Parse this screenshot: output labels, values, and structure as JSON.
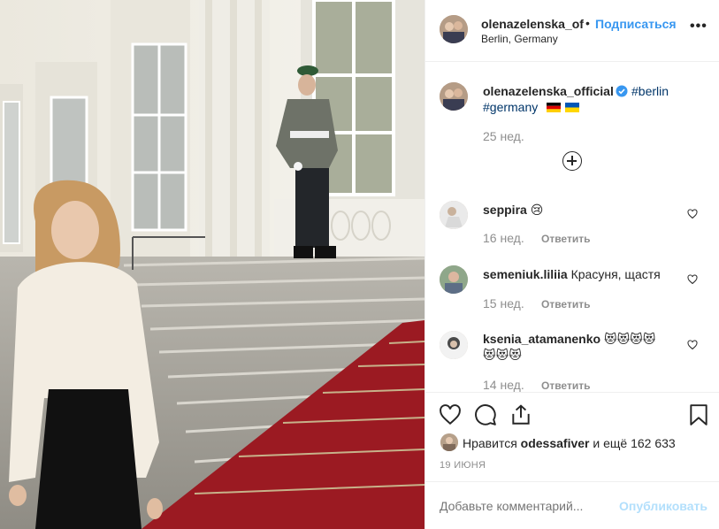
{
  "post": {
    "username": "olenazelenska_of",
    "separator": "•",
    "follow_label": "Подписаться",
    "location": "Berlin, Germany",
    "more_icon": "ellipsis-icon"
  },
  "caption": {
    "username": "olenazelenska_official",
    "hashtag1": "#berlin",
    "hashtag2": "#germany",
    "flags": [
      "flag-germany",
      "flag-ukraine"
    ],
    "time": "25 нед."
  },
  "comments": [
    {
      "username": "seppira",
      "text": "😢",
      "time": "16 нед.",
      "reply": "Ответить"
    },
    {
      "username": "semeniuk.liliia",
      "text": "Красуня, щастя",
      "time": "15 нед.",
      "reply": "Ответить"
    },
    {
      "username": "ksenia_atamanenko",
      "text": "😻😻😻😻",
      "text2": "😻😻😻",
      "time": "14 нед.",
      "reply": "Ответить"
    }
  ],
  "likes": {
    "prefix": "Нравится",
    "user": "odessafiver",
    "suffix": "и ещё 162 633"
  },
  "date": "19 ИЮНЯ",
  "add_comment": {
    "placeholder": "Добавьте комментарий...",
    "publish_label": "Опубликовать"
  },
  "colors": {
    "link_blue": "#3897f0",
    "hashtag": "#003569",
    "muted": "#8e8e8e",
    "publish_disabled": "#b2dffc",
    "carpet_red": "#9b1a22"
  }
}
